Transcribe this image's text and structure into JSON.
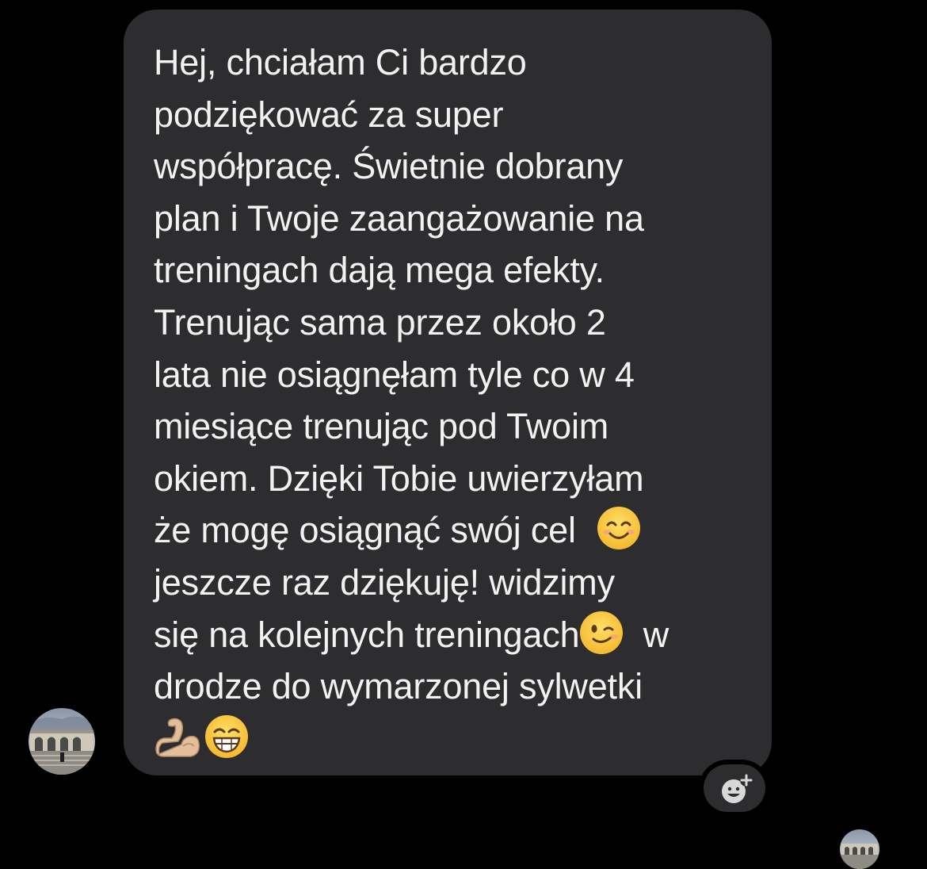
{
  "conversation": {
    "message": {
      "lines": [
        "Hej, chciałam Ci bardzo",
        "podziękować za super",
        "współpracę. Świetnie dobrany",
        "plan i Twoje zaangażowanie na",
        "treningach dają mega efekty.",
        "Trenując sama przez około 2",
        "lata nie osiągnęłam tyle co w 4",
        "miesiące trenując pod Twoim",
        "okiem. Dzięki Tobie uwierzyłam",
        "że mogę osiągnąć swój cel",
        "jeszcze raz dziękuję! widzimy",
        "się na kolejnych treningach",
        "w",
        "drodze do wymarzonej sylwetki"
      ],
      "emojis": [
        "smiling-face-emoji",
        "winking-face-emoji",
        "flexed-biceps-emoji",
        "grinning-face-emoji"
      ]
    },
    "react_button_icon": "add-reaction-icon",
    "avatar_icons": [
      "sender-avatar",
      "read-receipt-avatar"
    ]
  },
  "colors": {
    "background": "#000000",
    "bubble": "#2d2d30",
    "text": "#f2f2f2"
  }
}
